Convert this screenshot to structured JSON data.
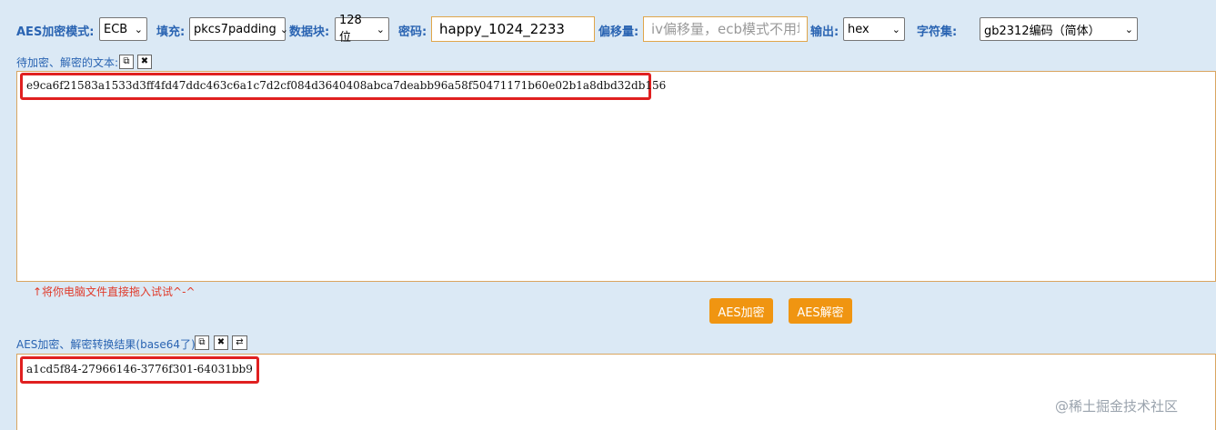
{
  "toolbar": {
    "mode_label": "AES加密模式:",
    "mode_value": "ECB",
    "padding_label": "填充:",
    "padding_value": "pkcs7padding",
    "block_label": "数据块:",
    "block_value": "128位",
    "password_label": "密码:",
    "password_value": "happy_1024_2233",
    "iv_label": "偏移量:",
    "iv_placeholder": "iv偏移量，ecb模式不用填",
    "output_label": "输出:",
    "output_value": "hex",
    "charset_label": "字符集:",
    "charset_value": "gb2312编码（简体）"
  },
  "input_section": {
    "label": "待加密、解密的文本:",
    "text": "e9ca6f21583a1533d3ff4fd47ddc463c6a1c7d2cf084d3640408abca7deabb96a58f50471171b60e02b1a8dbd32db156",
    "hint": "↑将你电脑文件直接拖入试试^-^"
  },
  "actions": {
    "encrypt_label": "AES加密",
    "decrypt_label": "AES解密"
  },
  "output_section": {
    "label": "AES加密、解密转换结果(base64了):",
    "text": "a1cd5f84-27966146-3776f301-64031bb9"
  },
  "watermark": "@稀土掘金技术社区",
  "colors": {
    "background": "#dbe9f5",
    "label_blue": "#2a64b2",
    "button_orange": "#f09511",
    "highlight_red": "#e02020"
  }
}
